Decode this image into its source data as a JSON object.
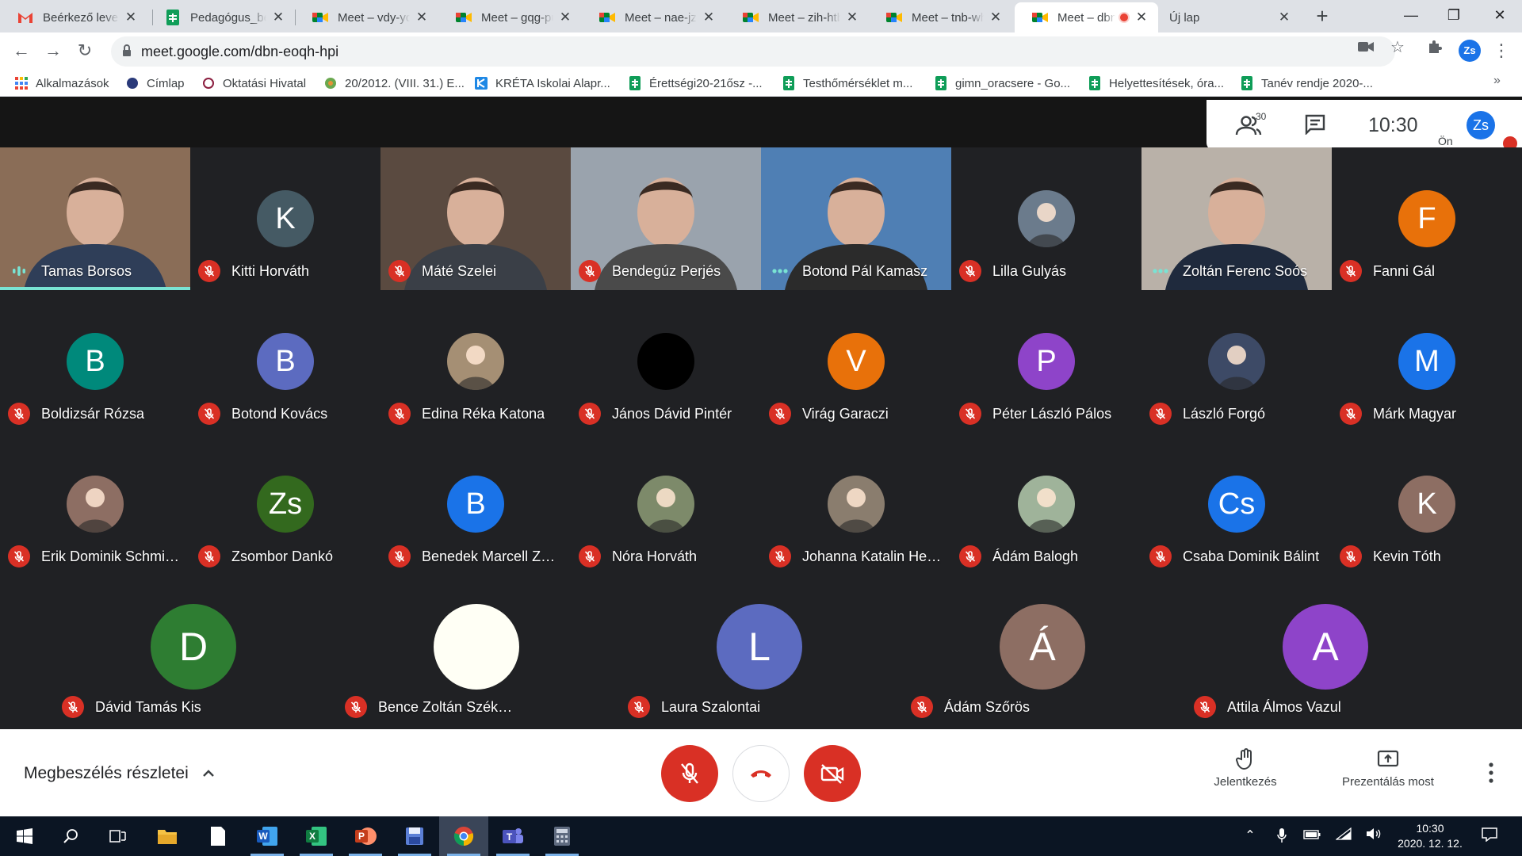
{
  "browser": {
    "tabs": [
      {
        "title": "Beérkező levelek",
        "icon": "gmail-icon"
      },
      {
        "title": "Pedagógus_bejelentkezés",
        "icon": "sheets-icon"
      },
      {
        "title": "Meet – vdy-yqc",
        "icon": "meet-icon"
      },
      {
        "title": "Meet – gqg-pur",
        "icon": "meet-icon"
      },
      {
        "title": "Meet – nae-jzm",
        "icon": "meet-icon"
      },
      {
        "title": "Meet – zih-htb",
        "icon": "meet-icon"
      },
      {
        "title": "Meet – tnb-wht",
        "icon": "meet-icon"
      },
      {
        "title": "Meet – dbn",
        "icon": "meet-icon",
        "active": true,
        "recording": true
      },
      {
        "title": "Új lap",
        "icon": "none"
      }
    ],
    "url": "meet.google.com/dbn-eoqh-hpi",
    "profile_initials": "Zs",
    "bookmarks": [
      {
        "label": "Alkalmazások",
        "icon": "apps-grid-icon"
      },
      {
        "label": "Címlap",
        "icon": "site-icon"
      },
      {
        "label": "Oktatási Hivatal",
        "icon": "site-icon"
      },
      {
        "label": "20/2012. (VIII. 31.) E...",
        "icon": "globe-icon"
      },
      {
        "label": "KRÉTA Iskolai Alapr...",
        "icon": "kreta-icon"
      },
      {
        "label": "Érettségi20-21ősz -...",
        "icon": "sheets-icon"
      },
      {
        "label": "Testhőmérséklet m...",
        "icon": "sheets-icon"
      },
      {
        "label": "gimn_oracsere - Go...",
        "icon": "sheets-icon"
      },
      {
        "label": "Helyettesítések, óra...",
        "icon": "sheets-icon"
      },
      {
        "label": "Tanév rendje 2020-...",
        "icon": "sheets-icon"
      }
    ],
    "more_bookmarks": "»"
  },
  "meet": {
    "participant_count": "30",
    "clock": "10:30",
    "self_initials": "Zs",
    "self_label": "Ön",
    "tiles": [
      {
        "name": "Tamas Borsos",
        "type": "video",
        "mic": "speaking",
        "bg": "#8a6d57"
      },
      {
        "name": "Kitti Horváth",
        "type": "avatar",
        "initial": "K",
        "color": "#455a64",
        "mic": "muted"
      },
      {
        "name": "Máté Szelei",
        "type": "video",
        "mic": "muted",
        "bg": "#5a4a40"
      },
      {
        "name": "Bendegúz Perjés",
        "type": "video",
        "mic": "muted",
        "bg": "#9aa3ad"
      },
      {
        "name": "Botond Pál Kamasz",
        "type": "video",
        "mic": "active",
        "bg": "#4f7fb4"
      },
      {
        "name": "Lilla Gulyás",
        "type": "photo",
        "color": "#6b7b8c",
        "mic": "muted"
      },
      {
        "name": "Zoltán Ferenc Soós",
        "type": "video",
        "mic": "active",
        "bg": "#b9b1a8"
      },
      {
        "name": "Fanni Gál",
        "type": "avatar",
        "initial": "F",
        "color": "#e8710a",
        "mic": "muted"
      },
      {
        "name": "Boldizsár Rózsa",
        "type": "avatar",
        "initial": "B",
        "color": "#00897b",
        "mic": "muted"
      },
      {
        "name": "Botond Kovács",
        "type": "avatar",
        "initial": "B",
        "color": "#5c6bc0",
        "mic": "muted"
      },
      {
        "name": "Edina Réka Katona",
        "type": "photo",
        "color": "#a58f74",
        "mic": "muted"
      },
      {
        "name": "János Dávid Pintér",
        "type": "photo",
        "color": "#000000",
        "mic": "muted"
      },
      {
        "name": "Virág Garaczi",
        "type": "avatar",
        "initial": "V",
        "color": "#e8710a",
        "mic": "muted"
      },
      {
        "name": "Péter László Pálos",
        "type": "avatar",
        "initial": "P",
        "color": "#8e44c9",
        "mic": "muted"
      },
      {
        "name": "László Forgó",
        "type": "photo",
        "color": "#3d4a66",
        "mic": "muted"
      },
      {
        "name": "Márk Magyar",
        "type": "avatar",
        "initial": "M",
        "color": "#1a73e8",
        "mic": "muted"
      },
      {
        "name": "Erik Dominik Schmiedt",
        "type": "photo",
        "color": "#8d6e63",
        "mic": "muted"
      },
      {
        "name": "Zsombor Dankó",
        "type": "avatar",
        "initial": "Zs",
        "color": "#33691e",
        "mic": "muted"
      },
      {
        "name": "Benedek Marcell Zoltán",
        "type": "avatar",
        "initial": "B",
        "color": "#1a73e8",
        "mic": "muted"
      },
      {
        "name": "Nóra Horváth",
        "type": "photo",
        "color": "#7d8a6a",
        "mic": "muted"
      },
      {
        "name": "Johanna Katalin Hegedűs",
        "type": "photo",
        "color": "#8a7d6e",
        "mic": "muted"
      },
      {
        "name": "Ádám Balogh",
        "type": "photo",
        "color": "#9fb39a",
        "mic": "muted"
      },
      {
        "name": "Csaba Dominik Bálint",
        "type": "avatar",
        "initial": "Cs",
        "color": "#1a73e8",
        "mic": "muted"
      },
      {
        "name": "Kevin Tóth",
        "type": "avatar",
        "initial": "K",
        "color": "#8d6e63",
        "mic": "muted"
      }
    ],
    "bottom_tiles": [
      {
        "name": "Dávid Tamás Kis",
        "initial": "D",
        "color": "#2e7d32",
        "mic": "muted"
      },
      {
        "name": "Bence Zoltán Székelyi",
        "initial": "",
        "color": "#fffff5",
        "mic": "muted"
      },
      {
        "name": "Laura Szalontai",
        "initial": "L",
        "color": "#5c6bc0",
        "mic": "muted"
      },
      {
        "name": "Ádám Szőrös",
        "initial": "Á",
        "color": "#8d6e63",
        "mic": "muted"
      },
      {
        "name": "Attila Álmos Vazul",
        "initial": "A",
        "color": "#8e44c9",
        "mic": "muted"
      }
    ],
    "controls": {
      "details_label": "Megbeszélés részletei",
      "raise_hand_label": "Jelentkezés",
      "present_label": "Prezentálás most"
    }
  },
  "taskbar": {
    "apps": [
      {
        "name": "start-button",
        "icon": "windows-logo-icon"
      },
      {
        "name": "search-button",
        "icon": "search-icon"
      },
      {
        "name": "task-view-button",
        "icon": "task-view-icon"
      },
      {
        "name": "file-explorer",
        "icon": "folder-icon"
      },
      {
        "name": "notepad",
        "icon": "document-icon"
      },
      {
        "name": "word",
        "icon": "word-icon",
        "running": true
      },
      {
        "name": "excel",
        "icon": "excel-icon",
        "running": true
      },
      {
        "name": "powerpoint",
        "icon": "powerpoint-icon",
        "running": true
      },
      {
        "name": "save-app",
        "icon": "floppy-icon",
        "running": true
      },
      {
        "name": "chrome",
        "icon": "chrome-icon",
        "running": true,
        "active": true
      },
      {
        "name": "teams",
        "icon": "teams-icon",
        "running": true
      },
      {
        "name": "calculator",
        "icon": "calculator-icon",
        "running": true
      }
    ],
    "time": "10:30",
    "date": "2020. 12. 12."
  },
  "colors": {
    "meet_bg": "#202124",
    "mute_red": "#d93025",
    "speaking_teal": "#79e3d3",
    "brand_blue": "#1a73e8"
  }
}
